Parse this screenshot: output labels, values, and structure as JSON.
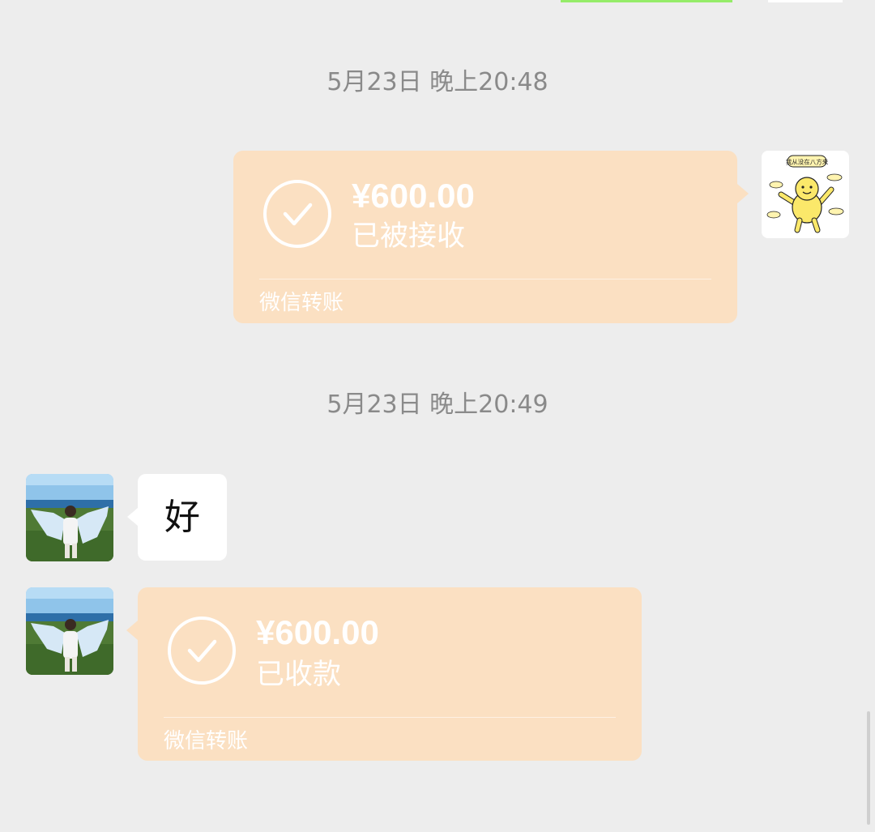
{
  "colors": {
    "background": "#ededed",
    "transfer_bubble": "#fbe0c2",
    "text_bubble": "#ffffff",
    "timestamp_text": "#8a8a8a"
  },
  "messages": [
    {
      "timestamp": "5月23日 晚上20:48",
      "type": "transfer",
      "direction": "outgoing",
      "amount": "¥600.00",
      "status": "已被接收",
      "footer": "微信转账",
      "icon": "check-circle-icon"
    },
    {
      "timestamp": "5月23日 晚上20:49",
      "type": "text",
      "direction": "incoming",
      "text": "好"
    },
    {
      "type": "transfer",
      "direction": "incoming",
      "amount": "¥600.00",
      "status": "已收款",
      "footer": "微信转账",
      "icon": "check-circle-icon"
    }
  ],
  "sticker_avatar": {
    "caption": "我从没在八方来"
  }
}
